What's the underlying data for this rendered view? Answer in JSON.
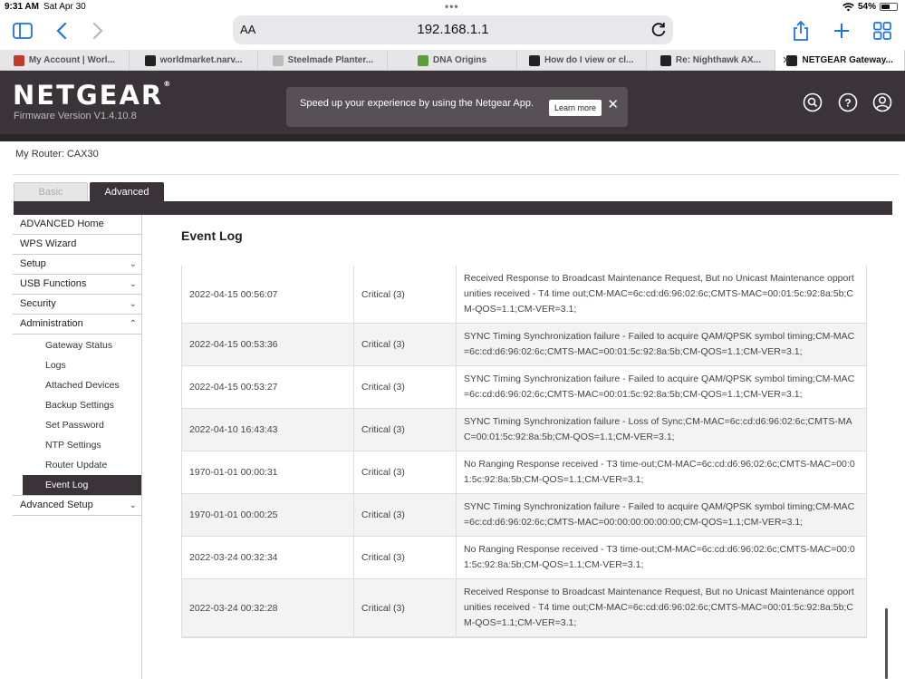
{
  "status": {
    "time": "9:31 AM",
    "date": "Sat Apr 30",
    "battery": "54%",
    "battery_level": 0.54
  },
  "browser": {
    "aa_label": "AA",
    "url": "192.168.1.1",
    "tabs": [
      {
        "label": "My Account | Worl...",
        "favicon": "wm-icon",
        "color": "#c0392b",
        "active": false
      },
      {
        "label": "worldmarket.narv...",
        "favicon": "narvar-icon",
        "color": "#222222",
        "active": false
      },
      {
        "label": "Steelmade Planter...",
        "favicon": "p-icon",
        "color": "#bbbbbb",
        "active": false
      },
      {
        "label": "DNA Origins",
        "favicon": "dna-icon",
        "color": "#5a9e3a",
        "active": false
      },
      {
        "label": "How do I view or cl...",
        "favicon": "n-icon",
        "color": "#222222",
        "active": false
      },
      {
        "label": "Re: Nighthawk AX...",
        "favicon": "n-icon",
        "color": "#222222",
        "active": false
      },
      {
        "label": "NETGEAR Gateway...",
        "favicon": "n-icon",
        "color": "#222222",
        "active": true
      }
    ]
  },
  "header": {
    "logo": "NETGEAR",
    "firmware": "Firmware Version V1.4.10.8",
    "promo_text": "Speed up your experience by using the Netgear App.",
    "promo_button": "Learn more"
  },
  "router": {
    "label": "My Router:",
    "model": "CAX30"
  },
  "mode_tabs": {
    "basic": "Basic",
    "advanced": "Advanced"
  },
  "sidebar": {
    "items": [
      {
        "label": "ADVANCED Home",
        "chevron": ""
      },
      {
        "label": "WPS Wizard",
        "chevron": ""
      },
      {
        "label": "Setup",
        "chevron": "﹀"
      },
      {
        "label": "USB Functions",
        "chevron": "﹀"
      },
      {
        "label": "Security",
        "chevron": "﹀"
      },
      {
        "label": "Administration",
        "chevron": "︿"
      }
    ],
    "sub": [
      "Gateway Status",
      "Logs",
      "Attached Devices",
      "Backup Settings",
      "Set Password",
      "NTP Settings",
      "Router Update",
      "Event Log"
    ],
    "after": {
      "label": "Advanced Setup",
      "chevron": "﹀"
    }
  },
  "main": {
    "title": "Event Log",
    "rows": [
      {
        "time": "2022-04-15 00:56:07",
        "priority": "Critical (3)",
        "desc": "Received Response to Broadcast Maintenance Request, But no Unicast Maintenance opportunities received - T4 time out;CM-MAC=6c:cd:d6:96:02:6c;CMTS-MAC=00:01:5c:92:8a:5b;CM-QOS=1.1;CM-VER=3.1;"
      },
      {
        "time": "2022-04-15 00:53:36",
        "priority": "Critical (3)",
        "desc": "SYNC Timing Synchronization failure - Failed to acquire QAM/QPSK symbol timing;CM-MAC=6c:cd:d6:96:02:6c;CMTS-MAC=00:01:5c:92:8a:5b;CM-QOS=1.1;CM-VER=3.1;"
      },
      {
        "time": "2022-04-15 00:53:27",
        "priority": "Critical (3)",
        "desc": "SYNC Timing Synchronization failure - Failed to acquire QAM/QPSK symbol timing;CM-MAC=6c:cd:d6:96:02:6c;CMTS-MAC=00:01:5c:92:8a:5b;CM-QOS=1.1;CM-VER=3.1;"
      },
      {
        "time": "2022-04-10 16:43:43",
        "priority": "Critical (3)",
        "desc": "SYNC Timing Synchronization failure - Loss of Sync;CM-MAC=6c:cd:d6:96:02:6c;CMTS-MAC=00:01:5c:92:8a:5b;CM-QOS=1.1;CM-VER=3.1;"
      },
      {
        "time": "1970-01-01 00:00:31",
        "priority": "Critical (3)",
        "desc": "No Ranging Response received - T3 time-out;CM-MAC=6c:cd:d6:96:02:6c;CMTS-MAC=00:01:5c:92:8a:5b;CM-QOS=1.1;CM-VER=3.1;"
      },
      {
        "time": "1970-01-01 00:00:25",
        "priority": "Critical (3)",
        "desc": "SYNC Timing Synchronization failure - Failed to acquire QAM/QPSK symbol timing;CM-MAC=6c:cd:d6:96:02:6c;CMTS-MAC=00:00:00:00:00:00;CM-QOS=1.1;CM-VER=3.1;"
      },
      {
        "time": "2022-03-24 00:32:34",
        "priority": "Critical (3)",
        "desc": "No Ranging Response received - T3 time-out;CM-MAC=6c:cd:d6:96:02:6c;CMTS-MAC=00:01:5c:92:8a:5b;CM-QOS=1.1;CM-VER=3.1;"
      },
      {
        "time": "2022-03-24 00:32:28",
        "priority": "Critical (3)",
        "desc": "Received Response to Broadcast Maintenance Request, But no Unicast Maintenance opportunities received - T4 time out;CM-MAC=6c:cd:d6:96:02:6c;CMTS-MAC=00:01:5c:92:8a:5b;CM-QOS=1.1;CM-VER=3.1;"
      }
    ]
  }
}
